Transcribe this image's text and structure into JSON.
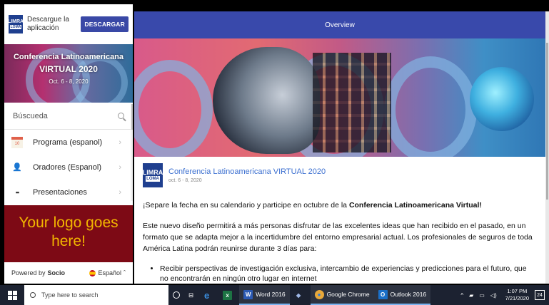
{
  "app": {
    "download_text": "Descargue la aplicación",
    "download_button": "DESCARGAR",
    "logo_top": "LIMRA",
    "logo_bottom": "LOMA"
  },
  "banner": {
    "line1": "Conferencia Latinoamericana",
    "line2": "VIRTUAL 2020",
    "dates": "Oct. 6 - 8, 2020"
  },
  "sidebar": {
    "search_label": "Búscueda",
    "items": [
      {
        "label": "Programa (espanol)",
        "icon": "calendar-icon",
        "icon_text": "10"
      },
      {
        "label": "Oradores (Espanol)",
        "icon": "speaker-icon",
        "icon_text": "👤"
      },
      {
        "label": "Presentaciones",
        "icon": "grid-icon",
        "icon_text": "▪▪"
      }
    ],
    "your_logo": "Your logo goes here!",
    "powered_by": "Powered by",
    "powered_brand": "Socio",
    "language": "Español"
  },
  "main": {
    "header_title": "Overview",
    "event_title": "Conferencia Latinoamericana VIRTUAL 2020",
    "event_dates": "oct. 6 - 8, 2020",
    "para1_prefix": "¡Separe la fecha en su calendario y participe en octubre de la ",
    "para1_bold": "Conferencia Latinoamericana Virtual",
    "para1_suffix": "!",
    "para2": "Este nuevo diseño permitirá a más personas disfrutar de las excelentes ideas que han recibido en el pasado, en un formato que se adapta mejor a la incertidumbre del entorno empresarial actual. Los profesionales de seguros de toda América Latina podrán reunirse durante 3 días para:",
    "bullet1": "Recibir perspectivas de investigación exclusiva, intercambio de experiencias y predicciones para el futuro, que no encontrarán en ningún otro lugar en internet"
  },
  "taskbar": {
    "search_placeholder": "Type here to search",
    "word_label": "Word 2016",
    "chrome_label": "Google Chrome",
    "outlook_label": "Outlook 2016",
    "time": "1:07 PM",
    "date": "7/21/2020",
    "notification_count": "24"
  }
}
